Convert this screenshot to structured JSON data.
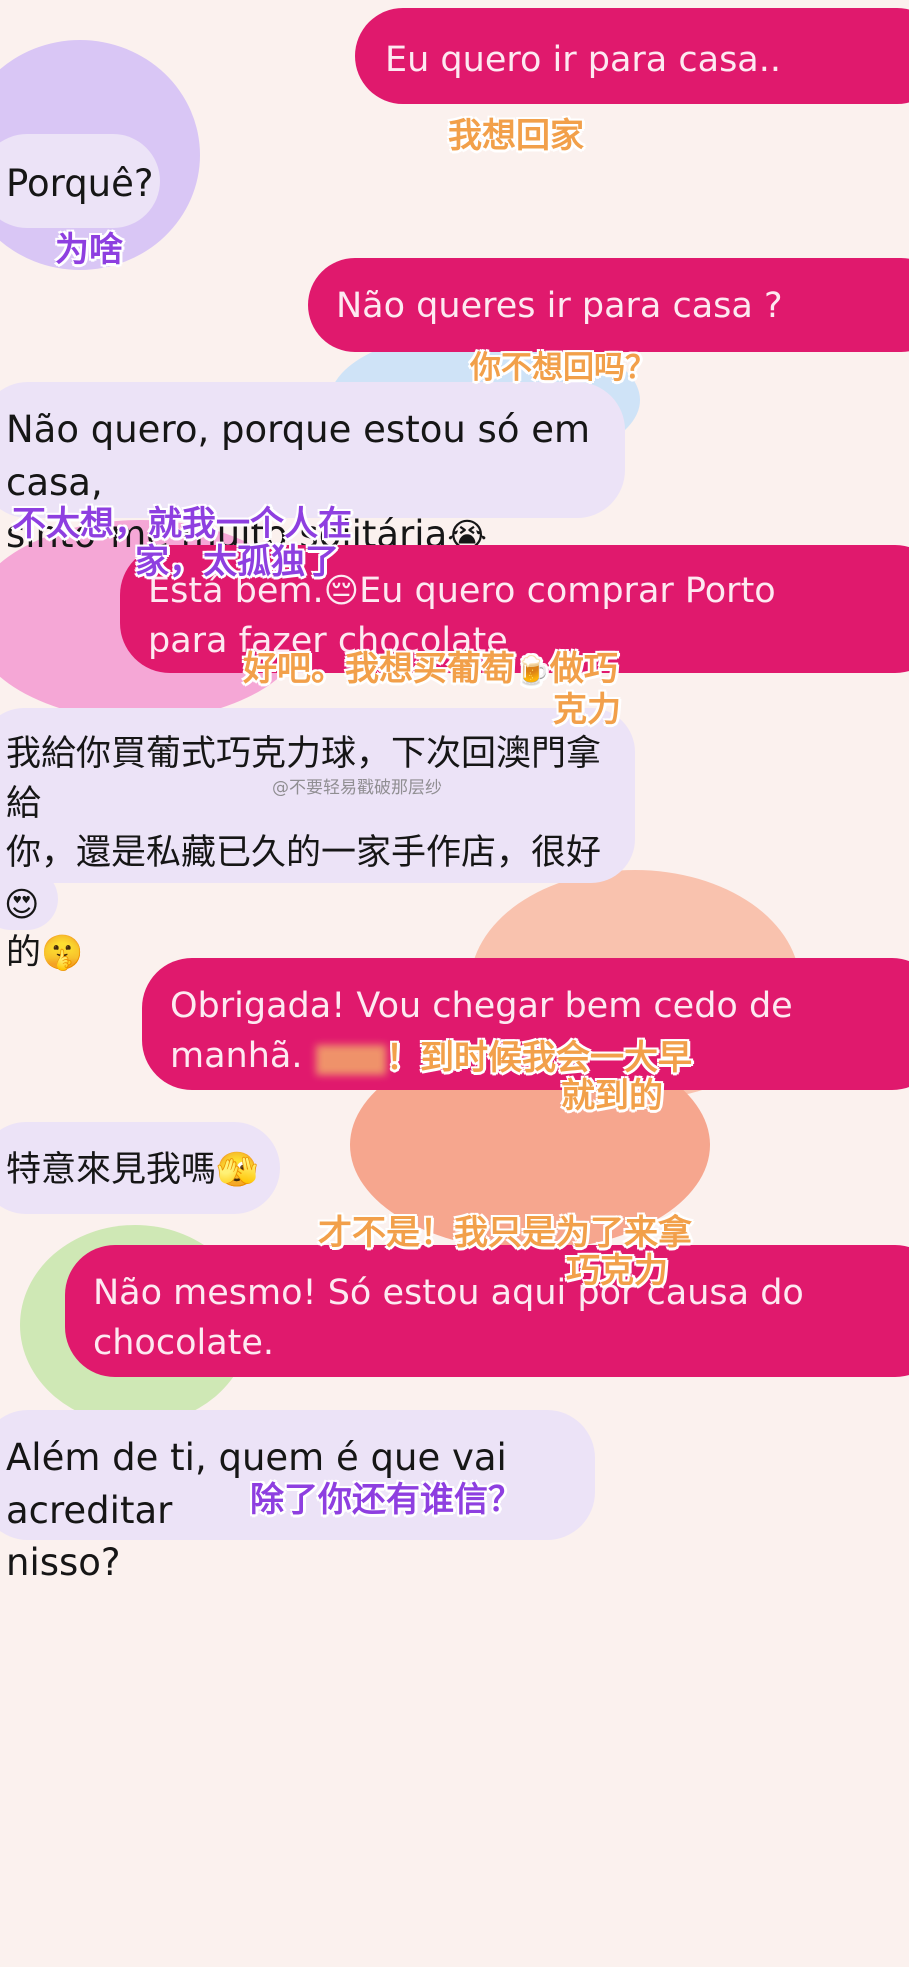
{
  "messages": [
    {
      "side": "sent",
      "text": "Eu quero ir para casa..",
      "translation": "我想回家"
    },
    {
      "side": "received",
      "text": "Porquê?",
      "translation": "为啥"
    },
    {
      "side": "sent",
      "text": "Não queres ir para casa ?",
      "translation": "你不想回吗？"
    },
    {
      "side": "received",
      "line1": "Não quero, porque estou só em casa,",
      "line2": "sinto-me muito solitária",
      "emoji": "😭",
      "translation_line1": "不太想，就我一个人在",
      "translation_line2": "家，太孤独了"
    },
    {
      "side": "sent",
      "line1_a": "Está bem.",
      "emoji": "😔",
      "line1_b": "Eu quero comprar Porto",
      "line2": "para fazer chocolate",
      "translation_line1": "好吧。我想买葡萄",
      "translation_emoji": "🍺",
      "translation_line1_b": "做巧",
      "translation_line2": "克力"
    },
    {
      "side": "received",
      "line1": "我給你買葡式巧克力球，下次回澳門拿給",
      "line2": "你，還是私藏已久的一家手作店，很好吃",
      "line3": "的",
      "emoji": "🤫"
    },
    {
      "side": "received",
      "emoji": "😍"
    },
    {
      "side": "sent",
      "line1": "Obrigada! Vou chegar bem cedo de",
      "line2": "manhã.",
      "translation_line1": "！到时候我会一大早",
      "translation_line2": "就到的"
    },
    {
      "side": "received",
      "text": "特意來見我嗎",
      "emoji": "🫣"
    },
    {
      "side": "sent",
      "line1": "Não mesmo! Só estou aqui por causa do",
      "line2": "chocolate.",
      "translation_line1": "才不是！我只是为了来拿",
      "translation_line2": "巧克力"
    },
    {
      "side": "received",
      "line1": "Além de ti, quem é que vai acreditar",
      "line2": "nisso?",
      "translation": "除了你还有谁信？"
    }
  ],
  "watermark": "@不要轻易戳破那层纱",
  "colors": {
    "sent_bubble": "#e0196d",
    "received_bubble": "#ece3f7",
    "background": "#fbf1ee",
    "translation_orange": "#f2a04a",
    "translation_purple": "#8e3fe0"
  }
}
